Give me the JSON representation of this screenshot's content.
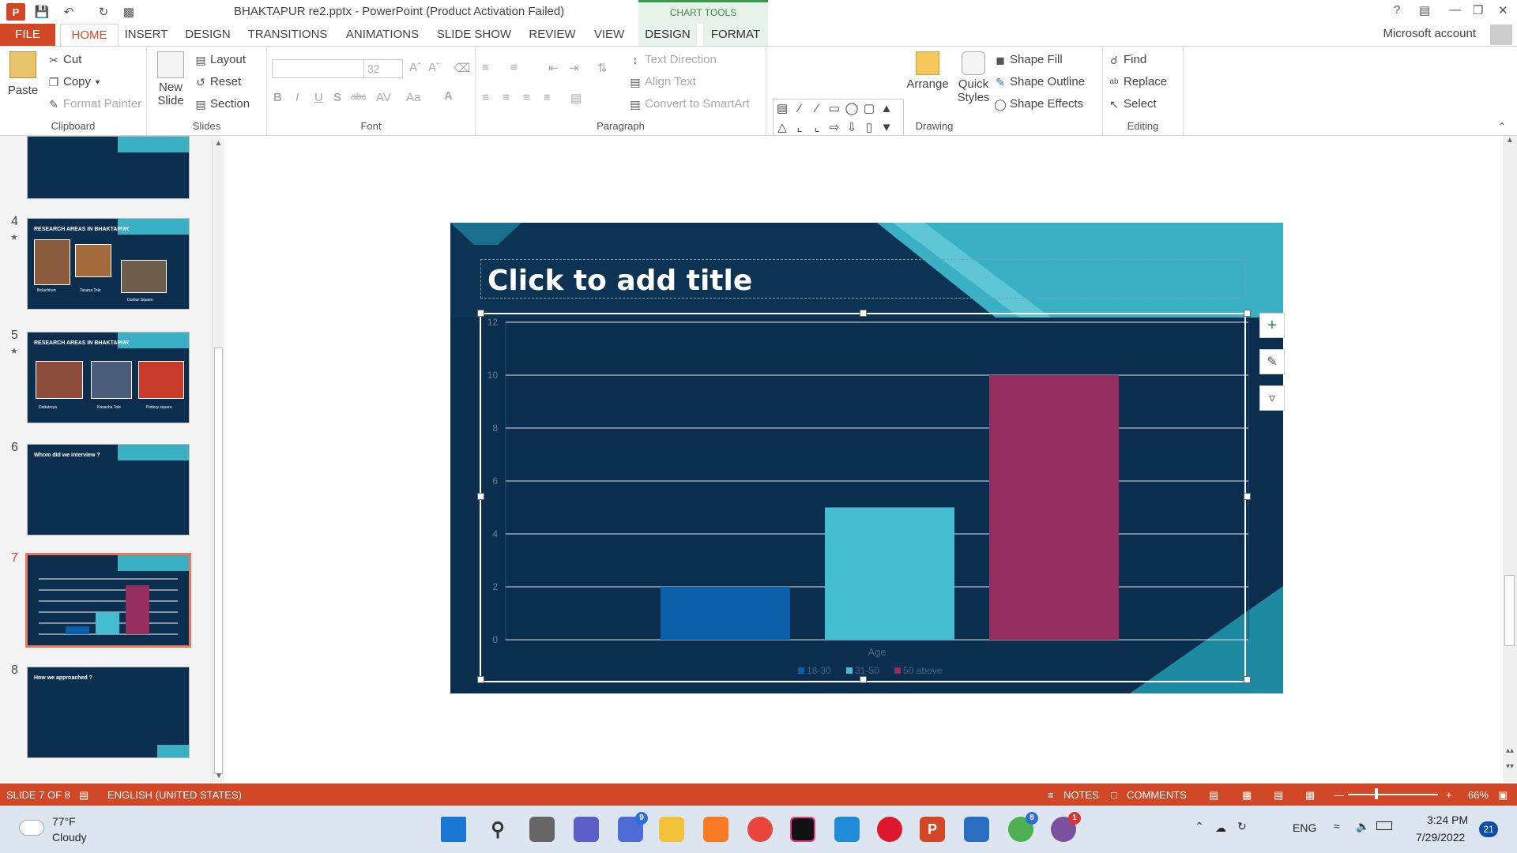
{
  "app": {
    "document_title": "BHAKTAPUR re2.pptx - PowerPoint (Product Activation Failed)",
    "chart_tools_label": "CHART TOOLS",
    "account": "Microsoft account"
  },
  "tabs": [
    {
      "label": "FILE"
    },
    {
      "label": "HOME"
    },
    {
      "label": "INSERT"
    },
    {
      "label": "DESIGN"
    },
    {
      "label": "TRANSITIONS"
    },
    {
      "label": "ANIMATIONS"
    },
    {
      "label": "SLIDE SHOW"
    },
    {
      "label": "REVIEW"
    },
    {
      "label": "VIEW"
    },
    {
      "label": "DESIGN"
    },
    {
      "label": "FORMAT"
    }
  ],
  "ribbon": {
    "clipboard": {
      "paste": "Paste",
      "cut": "Cut",
      "copy": "Copy",
      "format_painter": "Format Painter",
      "label": "Clipboard"
    },
    "slides": {
      "new_slide_1": "New",
      "new_slide_2": "Slide",
      "layout": "Layout",
      "reset": "Reset",
      "section": "Section",
      "label": "Slides"
    },
    "font": {
      "size": "32",
      "label": "Font"
    },
    "paragraph": {
      "text_direction": "Text Direction",
      "align_text": "Align Text",
      "convert": "Convert to SmartArt",
      "label": "Paragraph"
    },
    "drawing": {
      "arrange": "Arrange",
      "quick_styles_1": "Quick",
      "quick_styles_2": "Styles",
      "shape_fill": "Shape Fill",
      "shape_outline": "Shape Outline",
      "shape_effects": "Shape Effects",
      "label": "Drawing"
    },
    "editing": {
      "find": "Find",
      "replace": "Replace",
      "select": "Select",
      "label": "Editing"
    }
  },
  "thumbnails": [
    {
      "num": "4",
      "title": "RESEARCH AREAS IN BHAKTAPUR",
      "captions": [
        "Bolachhen",
        "Tasana Tole",
        "Durbar Square"
      ]
    },
    {
      "num": "5",
      "title": "RESEARCH AREAS IN BHAKTAPUR",
      "captions": [
        "Dattatreya",
        "Kasacha Tole",
        "Pottery square"
      ]
    },
    {
      "num": "6",
      "title": "Whom did we interview ?"
    },
    {
      "num": "7",
      "title": ""
    },
    {
      "num": "8",
      "title": "How we approached ?"
    }
  ],
  "slide": {
    "title_placeholder": "Click to add title"
  },
  "chart_data": {
    "type": "bar",
    "categories": [
      "Age"
    ],
    "series": [
      {
        "name": "18-30",
        "values": [
          2
        ],
        "color": "#0b5ea8"
      },
      {
        "name": "31-50",
        "values": [
          5
        ],
        "color": "#45bdd1"
      },
      {
        "name": "50 above",
        "values": [
          10
        ],
        "color": "#962d5f"
      }
    ],
    "ylim": [
      0,
      12
    ],
    "yticks": [
      "0",
      "2",
      "4",
      "6",
      "8",
      "10",
      "12"
    ],
    "xlabel": "Age",
    "legend_position": "bottom",
    "grid": true
  },
  "statusbar": {
    "slide_of": "SLIDE 7 OF 8",
    "language": "ENGLISH (UNITED STATES)",
    "notes": "NOTES",
    "comments": "COMMENTS",
    "zoom": "66%"
  },
  "taskbar": {
    "weather_temp": "77°F",
    "weather_desc": "Cloudy",
    "lang": "ENG",
    "time": "3:24 PM",
    "date": "7/29/2022",
    "notif_count": "21",
    "badges": {
      "teams": "9",
      "chrome": "8",
      "viber": "1"
    }
  }
}
